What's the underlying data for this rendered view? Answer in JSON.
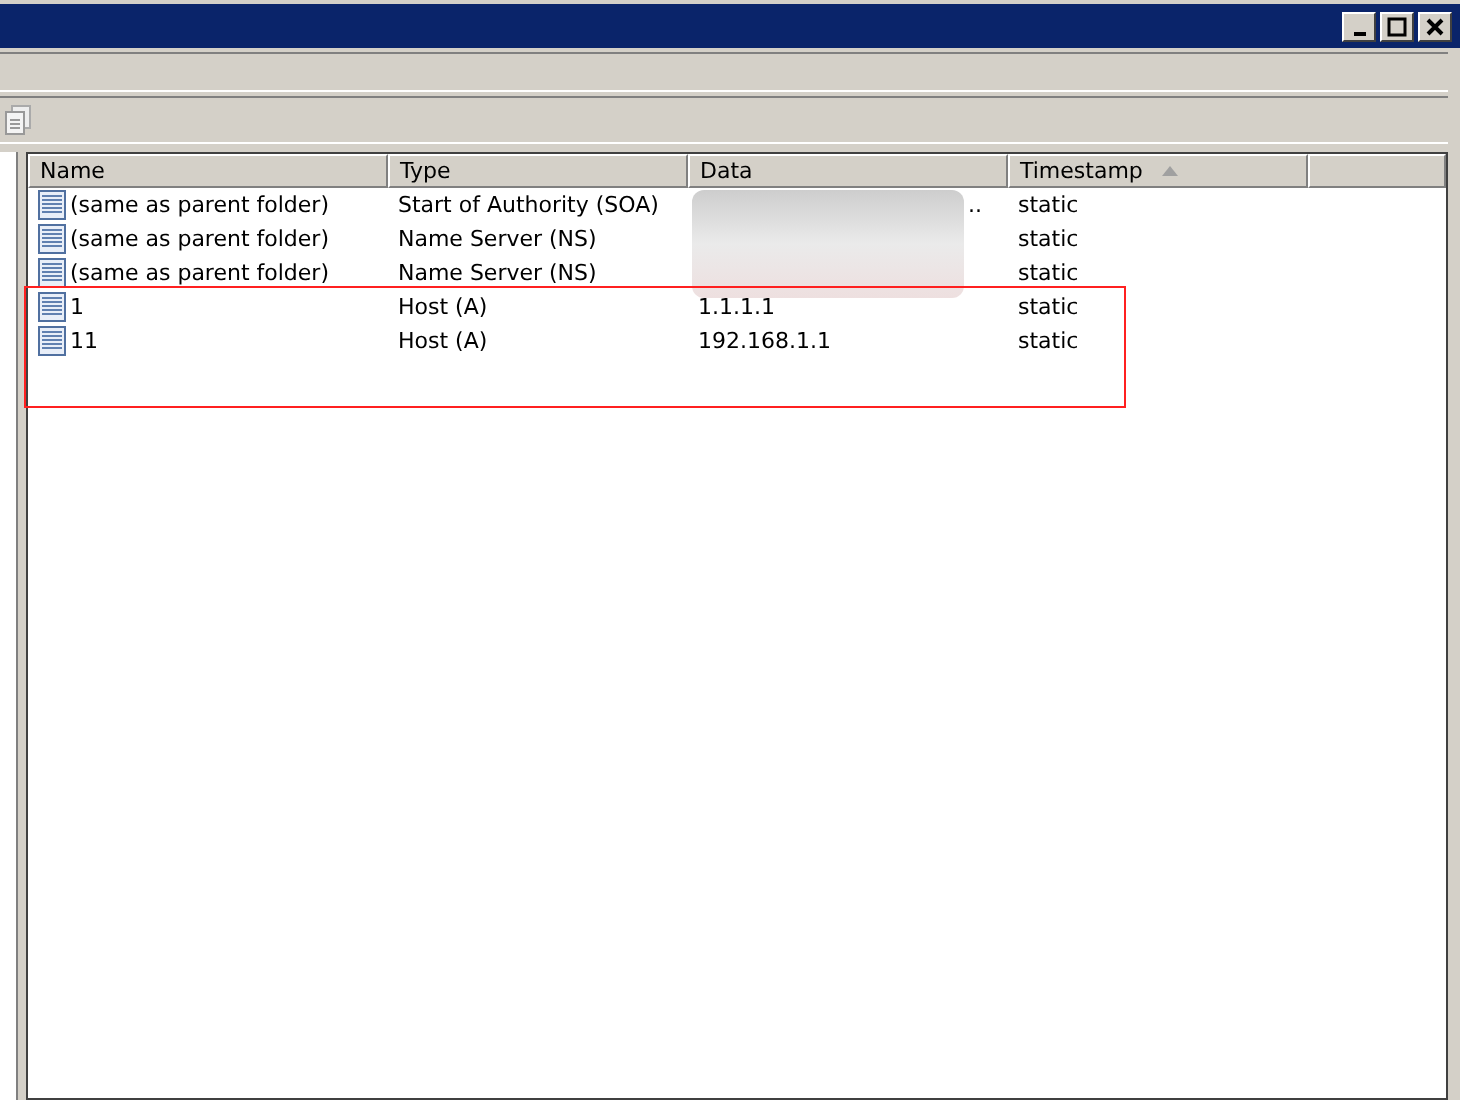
{
  "window": {
    "controls": [
      {
        "kind": "minimize"
      },
      {
        "kind": "maximize"
      },
      {
        "kind": "close"
      }
    ]
  },
  "table": {
    "columns": [
      {
        "label": "Name",
        "sorted": false
      },
      {
        "label": "Type",
        "sorted": false
      },
      {
        "label": "Data",
        "sorted": false
      },
      {
        "label": "Timestamp",
        "sorted": true
      },
      {
        "sorted": false
      }
    ],
    "rows": [
      {
        "name": "(same as parent folder)",
        "type": "Start of Authority (SOA)",
        "data": "..",
        "timestamp": "static"
      },
      {
        "name": "(same as parent folder)",
        "type": "Name Server (NS)",
        "timestamp": "static"
      },
      {
        "name": "(same as parent folder)",
        "type": "Name Server (NS)",
        "timestamp": "static"
      },
      {
        "name": "1",
        "type": "Host (A)",
        "data": "1.1.1.1",
        "timestamp": "static"
      },
      {
        "name": "11",
        "type": "Host (A)",
        "data": "192.168.1.1",
        "timestamp": "static"
      }
    ]
  },
  "overlays": [
    {
      "kind": "blur"
    },
    {
      "kind": "highlight-box"
    }
  ]
}
